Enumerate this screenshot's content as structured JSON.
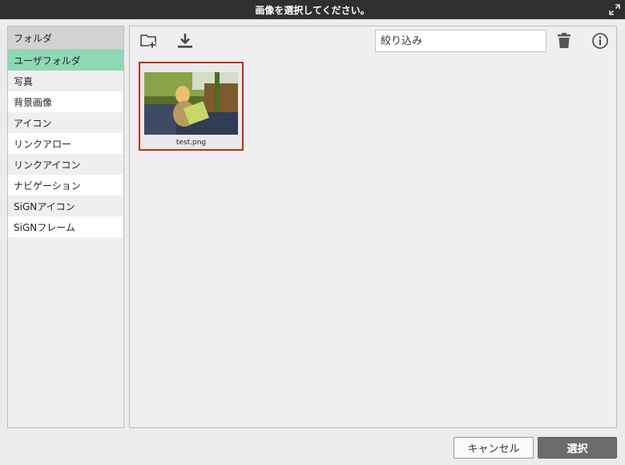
{
  "dialog": {
    "title": "画像を選択してください。"
  },
  "sidebar": {
    "header": "フォルダ",
    "items": [
      {
        "label": "ユーザフォルダ"
      },
      {
        "label": "写真"
      },
      {
        "label": "背景画像"
      },
      {
        "label": "アイコン"
      },
      {
        "label": "リンクアロー"
      },
      {
        "label": "リンクアイコン"
      },
      {
        "label": "ナビゲーション"
      },
      {
        "label": "SiGNアイコン"
      },
      {
        "label": "SiGNフレーム"
      }
    ]
  },
  "toolbar": {
    "filter_placeholder": "絞り込み",
    "icons": [
      "new-folder-icon",
      "download-icon",
      "trash-icon",
      "info-icon"
    ]
  },
  "files": [
    {
      "name": "test.png",
      "selected": true
    }
  ],
  "footer": {
    "cancel_label": "キャンセル",
    "select_label": "選択"
  },
  "colors": {
    "titlebar": "#2f2f2f",
    "selected_folder": "#8ed8b5",
    "selected_file_border": "#b5341c",
    "primary_button": "#6b6b6b"
  }
}
